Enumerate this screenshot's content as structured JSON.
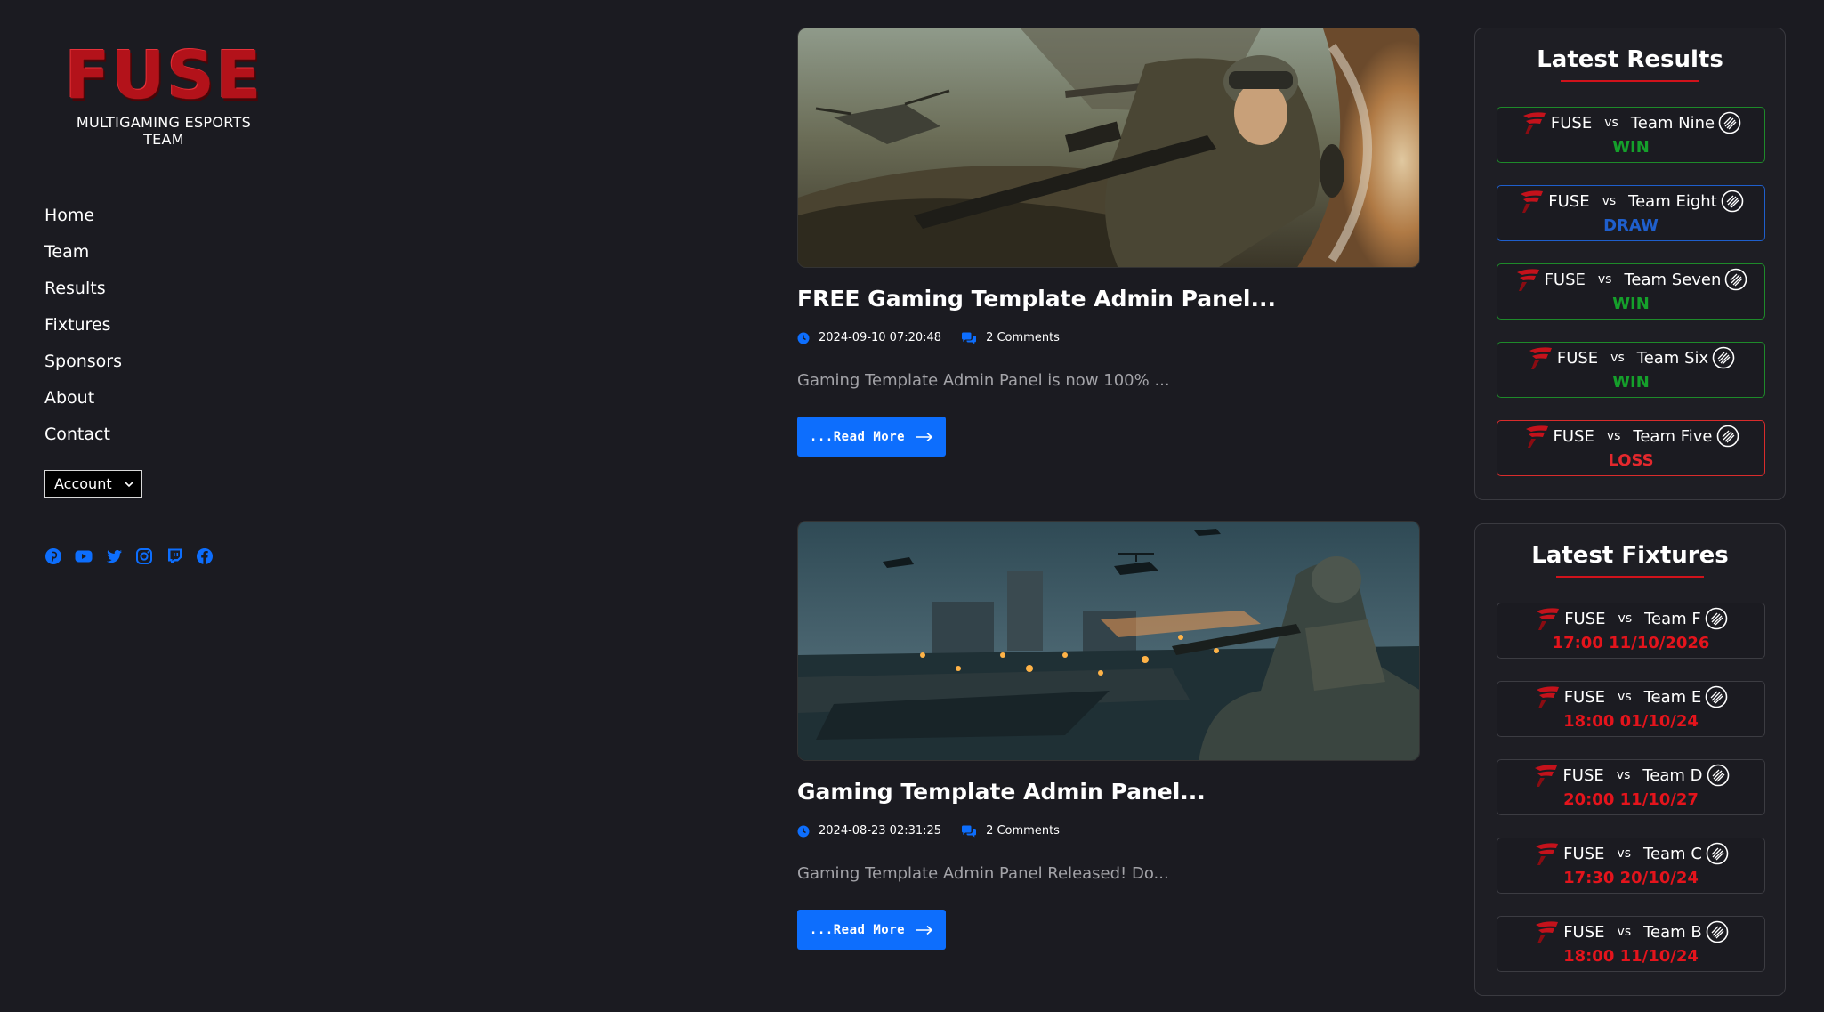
{
  "brand": {
    "logo_text": "FUSE",
    "tagline": "MULTIGAMING ESPORTS TEAM",
    "accent_color": "#b3121a"
  },
  "nav": {
    "items": [
      "Home",
      "Team",
      "Results",
      "Fixtures",
      "Sponsors",
      "About",
      "Contact"
    ],
    "account_label": "Account"
  },
  "socials": [
    "pinterest-icon",
    "youtube-icon",
    "twitter-icon",
    "instagram-icon",
    "twitch-icon",
    "facebook-icon"
  ],
  "posts": [
    {
      "title": "FREE Gaming Template Admin Panel...",
      "date": "2024-09-10 07:20:48",
      "comments": "2 Comments",
      "excerpt": "Gaming Template Admin Panel is now 100% ...",
      "read_more": "...Read More"
    },
    {
      "title": "Gaming Template Admin Panel...",
      "date": "2024-08-23 02:31:25",
      "comments": "2 Comments",
      "excerpt": "Gaming Template Admin Panel Released! Do...",
      "read_more": "...Read More"
    }
  ],
  "latest_results": {
    "title": "Latest Results",
    "matches": [
      {
        "home": "FUSE",
        "vs": "vs",
        "away": "Team Nine",
        "result": "WIN"
      },
      {
        "home": "FUSE",
        "vs": "vs",
        "away": "Team Eight",
        "result": "DRAW"
      },
      {
        "home": "FUSE",
        "vs": "vs",
        "away": "Team Seven",
        "result": "WIN"
      },
      {
        "home": "FUSE",
        "vs": "vs",
        "away": "Team Six",
        "result": "WIN"
      },
      {
        "home": "FUSE",
        "vs": "vs",
        "away": "Team Five",
        "result": "LOSS"
      }
    ]
  },
  "latest_fixtures": {
    "title": "Latest Fixtures",
    "matches": [
      {
        "home": "FUSE",
        "vs": "vs",
        "away": "Team F",
        "time": "17:00 11/10/2026"
      },
      {
        "home": "FUSE",
        "vs": "vs",
        "away": "Team E",
        "time": "18:00 01/10/24"
      },
      {
        "home": "FUSE",
        "vs": "vs",
        "away": "Team D",
        "time": "20:00 11/10/27"
      },
      {
        "home": "FUSE",
        "vs": "vs",
        "away": "Team C",
        "time": "17:30 20/10/24"
      },
      {
        "home": "FUSE",
        "vs": "vs",
        "away": "Team B",
        "time": "18:00 11/10/24"
      }
    ]
  },
  "colors": {
    "background": "#1b1b21",
    "primary_button": "#0d6efd",
    "win": "#15a02b",
    "draw": "#1f5fcc",
    "loss": "#e4282d"
  }
}
